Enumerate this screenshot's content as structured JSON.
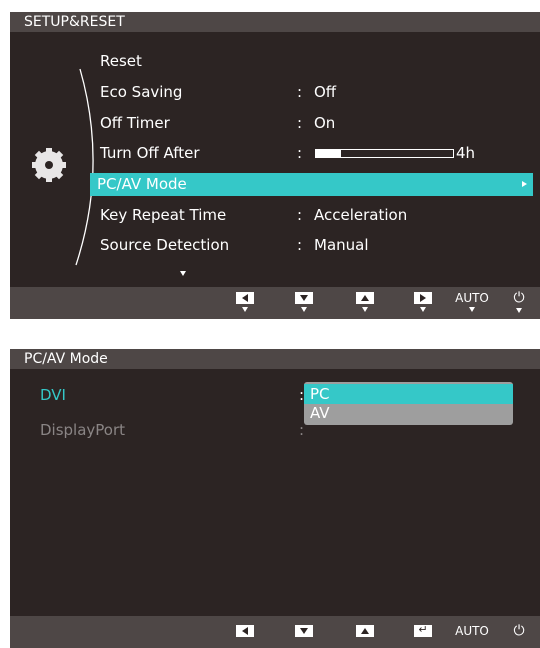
{
  "panel1": {
    "title": "SETUP&RESET",
    "items": [
      {
        "label": "Reset",
        "value": ""
      },
      {
        "label": "Eco Saving",
        "value": "Off"
      },
      {
        "label": "Off Timer",
        "value": "On"
      },
      {
        "label": "Turn Off After",
        "value": "4h",
        "slider_fraction": 0.18
      },
      {
        "label": "PC/AV Mode",
        "value": "",
        "selected": true
      },
      {
        "label": "Key Repeat Time",
        "value": "Acceleration"
      },
      {
        "label": "Source Detection",
        "value": "Manual"
      }
    ],
    "colon": ":",
    "buttons": [
      "left-arrow",
      "down-arrow",
      "up-arrow",
      "right-arrow"
    ],
    "auto_label": "AUTO",
    "power_symbol": "⏻"
  },
  "panel2": {
    "title": "PC/AV Mode",
    "items": [
      {
        "label": "DVI",
        "active": true
      },
      {
        "label": "DisplayPort",
        "active": false
      }
    ],
    "colon": ":",
    "options": [
      "PC",
      "AV"
    ],
    "selected_option": "PC",
    "buttons": [
      "left-arrow",
      "down-arrow",
      "up-arrow",
      "enter"
    ],
    "enter_symbol": "↵",
    "auto_label": "AUTO",
    "power_symbol": "⏻"
  },
  "colors": {
    "background": "#2c2423",
    "bar": "#4e4746",
    "accent": "#35c8c8",
    "inactive_text": "#8a8585",
    "popup": "#9e9e9e"
  }
}
